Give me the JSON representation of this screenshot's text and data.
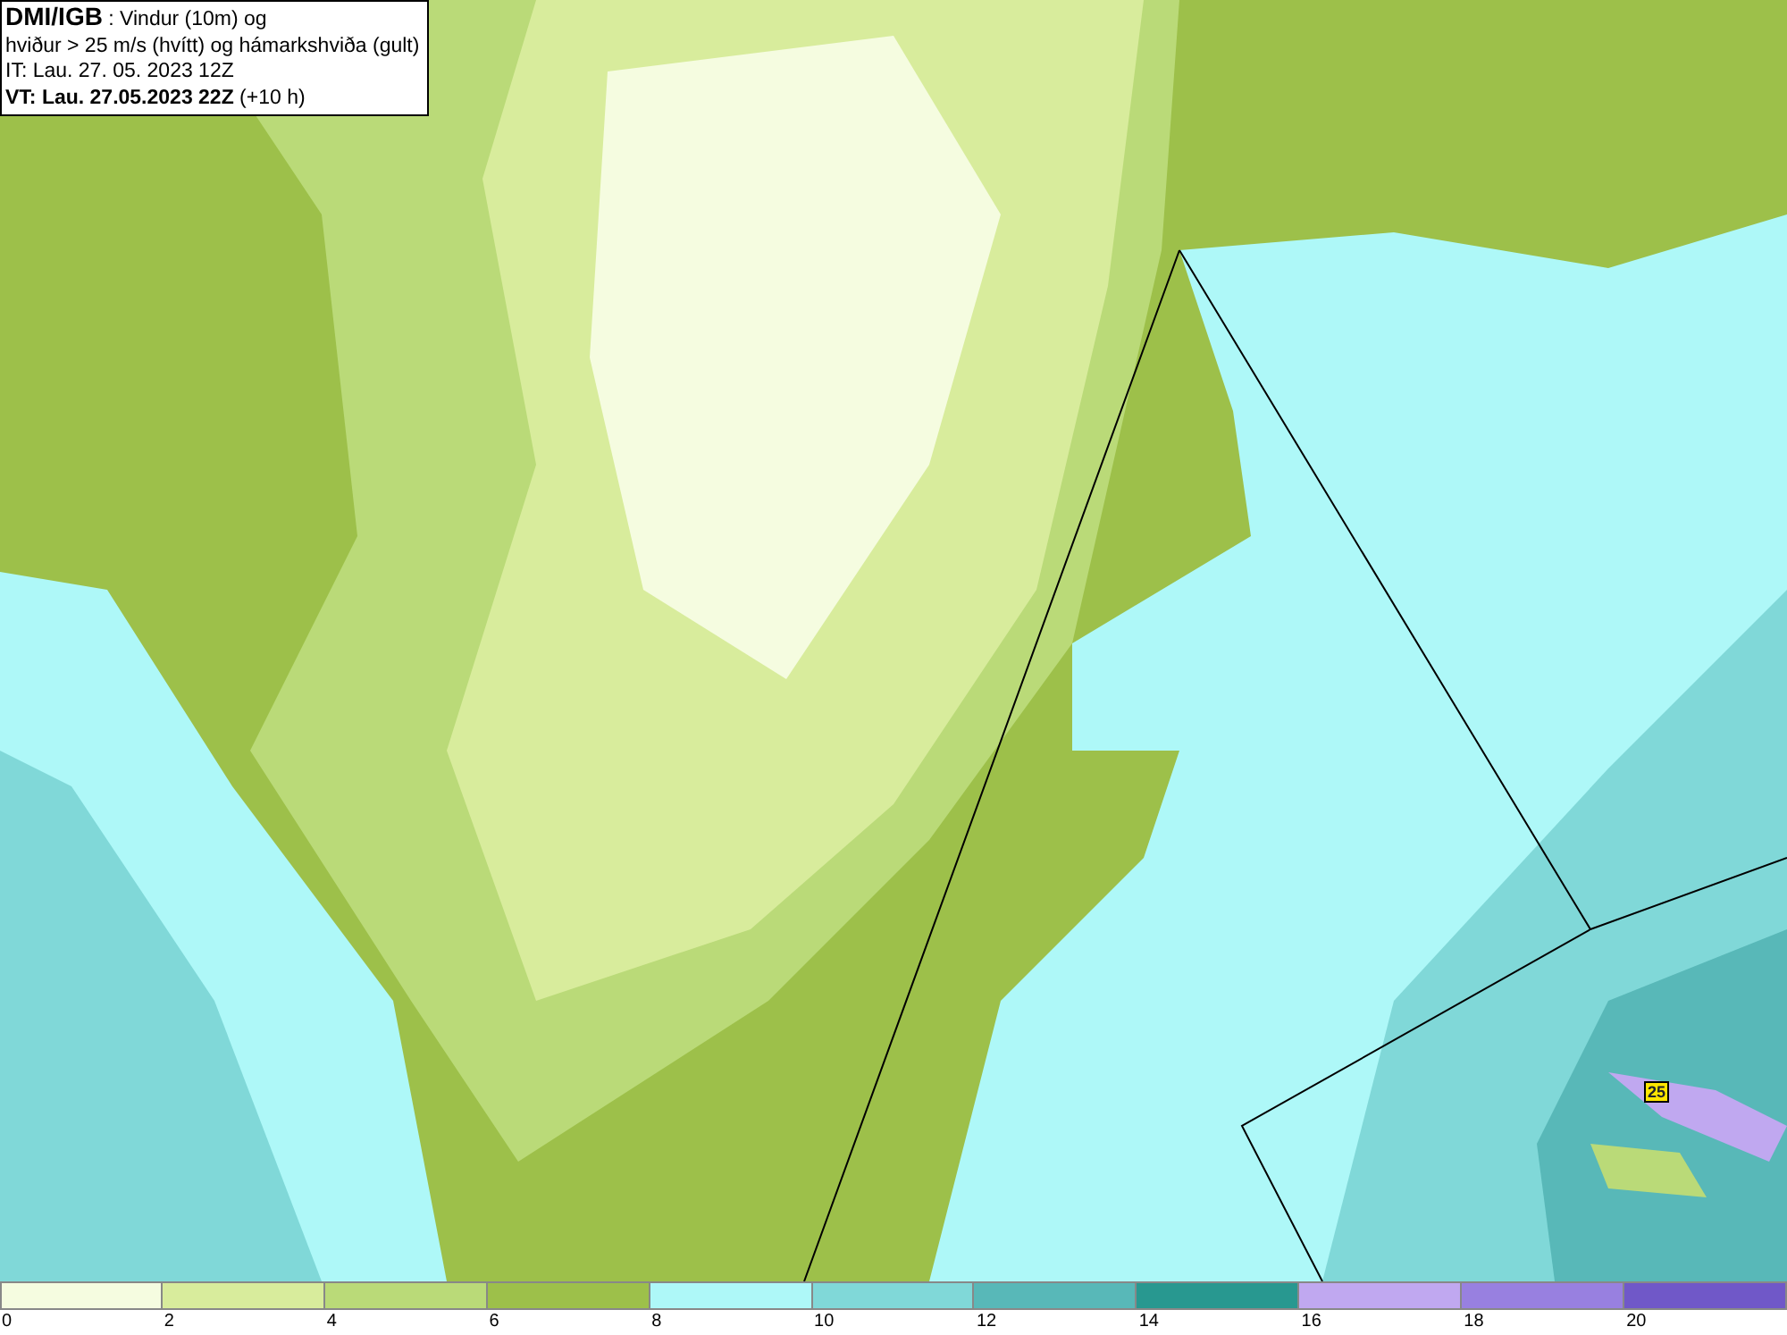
{
  "header": {
    "lines": [
      "**DMI/IGB** : Vindur (10m) og",
      "hviður > 25 m/s (hvítt) og hámarkshviða (gult)",
      "IT: Lau. 27. 05. 2023 12Z",
      "**VT: Lau. 27.05.2023 22Z** (+10 h)"
    ]
  },
  "map": {
    "max_gust_label": "25"
  },
  "legend": {
    "bins": [
      {
        "label": "0",
        "color": "#f5fce0"
      },
      {
        "label": "2",
        "color": "#d8ec9c"
      },
      {
        "label": "4",
        "color": "#bada78"
      },
      {
        "label": "6",
        "color": "#9dc04a"
      },
      {
        "label": "8",
        "color": "#aef8f8"
      },
      {
        "label": "10",
        "color": "#80d8d8"
      },
      {
        "label": "12",
        "color": "#58b8b8"
      },
      {
        "label": "14",
        "color": "#289890"
      },
      {
        "label": "16",
        "color": "#c0a8f0"
      },
      {
        "label": "18",
        "color": "#9880e0"
      },
      {
        "label": "20",
        "color": "#7058c8"
      }
    ]
  }
}
